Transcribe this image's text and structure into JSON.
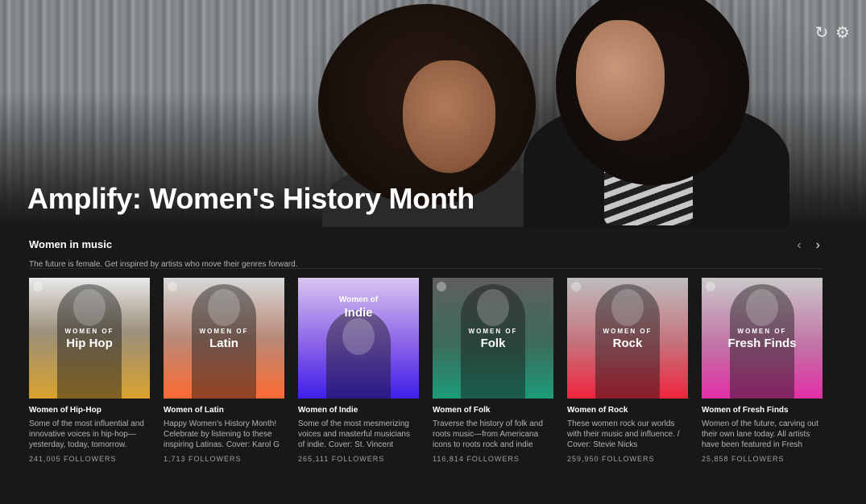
{
  "hero": {
    "title": "Amplify: Women's History Month"
  },
  "top_icons": {
    "refresh": "↻",
    "settings": "⚙"
  },
  "section": {
    "title": "Women in music",
    "subtitle": "The future is female. Get inspired by artists who move their genres forward.",
    "prev": "‹",
    "next": "›"
  },
  "cards": [
    {
      "title": "Women of Hip-Hop",
      "desc": "Some of the most influential and innovative voices in hip-hop—yesterday, today, tomorrow.",
      "followers": "241,005 FOLLOWERS",
      "cover_kicker": "WOMEN OF",
      "cover_genre": "Hip Hop"
    },
    {
      "title": "Women of Latin",
      "desc": "Happy Women's History Month! Celebrate by listening to these inspiring Latinas. Cover: Karol G",
      "followers": "1,713 FOLLOWERS",
      "cover_kicker": "WOMEN OF",
      "cover_genre": "Latin"
    },
    {
      "title": "Women of Indie",
      "desc": "Some of the most mesmerizing voices and masterful musicians of indie. Cover: St. Vincent",
      "followers": "265,111 FOLLOWERS",
      "cover_kicker": "Women of",
      "cover_genre": "Indie"
    },
    {
      "title": "Women of Folk",
      "desc": "Traverse the history of folk and roots music—from Americana icons to roots rock and indie folk...",
      "followers": "116,814 FOLLOWERS",
      "cover_kicker": "WOMEN OF",
      "cover_genre": "Folk"
    },
    {
      "title": "Women of Rock",
      "desc": "These women rock our worlds with their music and influence. / Cover: Stevie Nicks",
      "followers": "259,950 FOLLOWERS",
      "cover_kicker": "WOMEN OF",
      "cover_genre": "Rock"
    },
    {
      "title": "Women of Fresh Finds",
      "desc": "Women of the future, carving out their own lane today. All artists have been featured in Fresh Find...",
      "followers": "25,858 FOLLOWERS",
      "cover_kicker": "WOMEN OF",
      "cover_genre": "Fresh Finds"
    }
  ]
}
